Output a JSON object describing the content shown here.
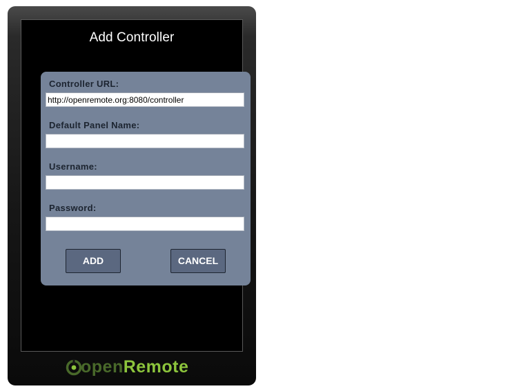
{
  "dialog": {
    "title": "Add Controller",
    "fields": [
      {
        "label": "Controller URL:",
        "value": "http://openremote.org:8080/controller",
        "placeholder": ""
      },
      {
        "label": "Default Panel Name:",
        "value": "",
        "placeholder": ""
      },
      {
        "label": "Username:",
        "value": "",
        "placeholder": ""
      },
      {
        "label": "Password:",
        "value": "",
        "placeholder": ""
      }
    ],
    "buttons": {
      "add": "ADD",
      "cancel": "CANCEL"
    }
  },
  "brand": {
    "logo_prefix": "open",
    "logo_suffix": "Remote",
    "logo_icon": "openremote-logo-icon",
    "colors": {
      "dark_green": "#49692a",
      "light_green": "#8cc43c",
      "panel": "#758399",
      "button": "#5b6880"
    }
  }
}
